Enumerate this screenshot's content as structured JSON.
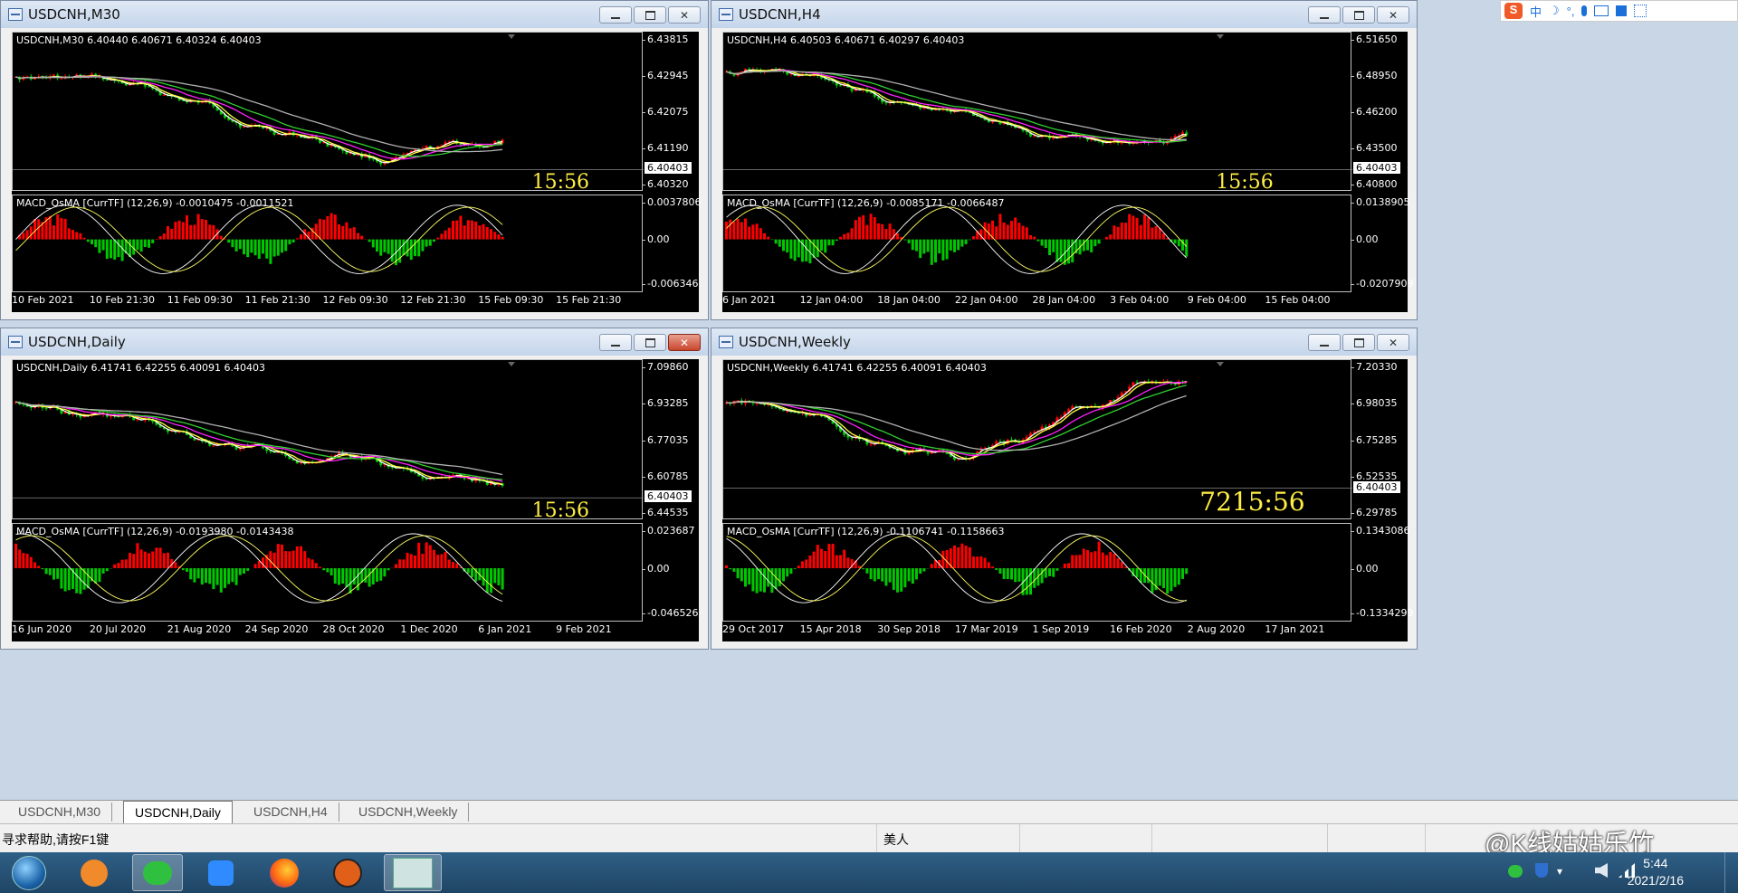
{
  "windows": [
    {
      "id": "m30",
      "title": "USDCNH,M30",
      "close_red": false,
      "header": "USDCNH,M30  6.40440 6.40671 6.40324 6.40403",
      "price_ticks": [
        "6.43815",
        "6.42945",
        "6.42075",
        "6.41190",
        "6.40320"
      ],
      "current_price": "6.40403",
      "timer": "15:56",
      "macd_label": "MACD_OsMA [CurrTF] (12,26,9) -0.0010475 -0.0011521",
      "macd_ticks": [
        "0.0037806",
        "0.00",
        "-0.006346"
      ],
      "time_ticks": [
        "10 Feb 2021",
        "10 Feb 21:30",
        "11 Feb 09:30",
        "11 Feb 21:30",
        "12 Feb 09:30",
        "12 Feb 21:30",
        "15 Feb 09:30",
        "15 Feb 21:30"
      ]
    },
    {
      "id": "h4",
      "title": "USDCNH,H4",
      "close_red": false,
      "header": "USDCNH,H4  6.40503 6.40671 6.40297 6.40403",
      "price_ticks": [
        "6.51650",
        "6.48950",
        "6.46200",
        "6.43500",
        "6.40800"
      ],
      "current_price": "6.40403",
      "timer": "15:56",
      "macd_label": "MACD_OsMA [CurrTF] (12,26,9) -0.0085171 -0.0066487",
      "macd_ticks": [
        "0.0138905",
        "0.00",
        "-0.0207909"
      ],
      "time_ticks": [
        "6 Jan 2021",
        "12 Jan 04:00",
        "18 Jan 04:00",
        "22 Jan 04:00",
        "28 Jan 04:00",
        "3 Feb 04:00",
        "9 Feb 04:00",
        "15 Feb 04:00"
      ]
    },
    {
      "id": "daily",
      "title": "USDCNH,Daily",
      "close_red": true,
      "header": "USDCNH,Daily  6.41741 6.42255 6.40091 6.40403",
      "price_ticks": [
        "7.09860",
        "6.93285",
        "6.77035",
        "6.60785",
        "6.44535"
      ],
      "current_price": "6.40403",
      "timer": "15:56",
      "macd_label": "MACD_OsMA [CurrTF] (12,26,9) -0.0193980 -0.0143438",
      "macd_ticks": [
        "0.023687",
        "0.00",
        "-0.046526"
      ],
      "time_ticks": [
        "16 Jun 2020",
        "20 Jul 2020",
        "21 Aug 2020",
        "24 Sep 2020",
        "28 Oct 2020",
        "1 Dec 2020",
        "6 Jan 2021",
        "9 Feb 2021"
      ]
    },
    {
      "id": "weekly",
      "title": "USDCNH,Weekly",
      "close_red": false,
      "header": "USDCNH,Weekly  6.41741 6.42255 6.40091 6.40403",
      "price_ticks": [
        "7.20330",
        "6.98035",
        "6.75285",
        "6.52535",
        "6.29785"
      ],
      "current_price": "6.40403",
      "timer": "7215:56",
      "macd_label": "MACD_OsMA [CurrTF] (12,26,9) -0.1106741 -0.1158663",
      "macd_ticks": [
        "0.1343086",
        "0.00",
        "-0.1334299"
      ],
      "time_ticks": [
        "29 Oct 2017",
        "15 Apr 2018",
        "30 Sep 2018",
        "17 Mar 2019",
        "1 Sep 2019",
        "16 Feb 2020",
        "2 Aug 2020",
        "17 Jan 2021"
      ]
    }
  ],
  "tabs": [
    "USDCNH,M30",
    "USDCNH,Daily",
    "USDCNH,H4",
    "USDCNH,Weekly"
  ],
  "active_tab": "USDCNH,Daily",
  "status": {
    "help_text": "寻求帮助,请按F1键",
    "profile": "美人"
  },
  "watermark": "@K线姑姑乐竹",
  "clock": {
    "time": "5:44",
    "date": "2021/2/16"
  },
  "taskbar_apps": [
    "start-orb-icon",
    "app-orange-icon",
    "wechat-icon",
    "note-icon",
    "firefox-icon",
    "ninja-icon",
    "trading-terminal-icon"
  ],
  "ime_bar": [
    "中",
    "☽",
    "°,"
  ],
  "colors": {
    "bull": "#ff0000",
    "bear": "#00c800",
    "ma_fast": "#ffffff",
    "ma_yellow": "#ffff40",
    "ma_magenta": "#ff20ff",
    "ma_green": "#30d030",
    "ma_grey": "#b0b0b0"
  }
}
